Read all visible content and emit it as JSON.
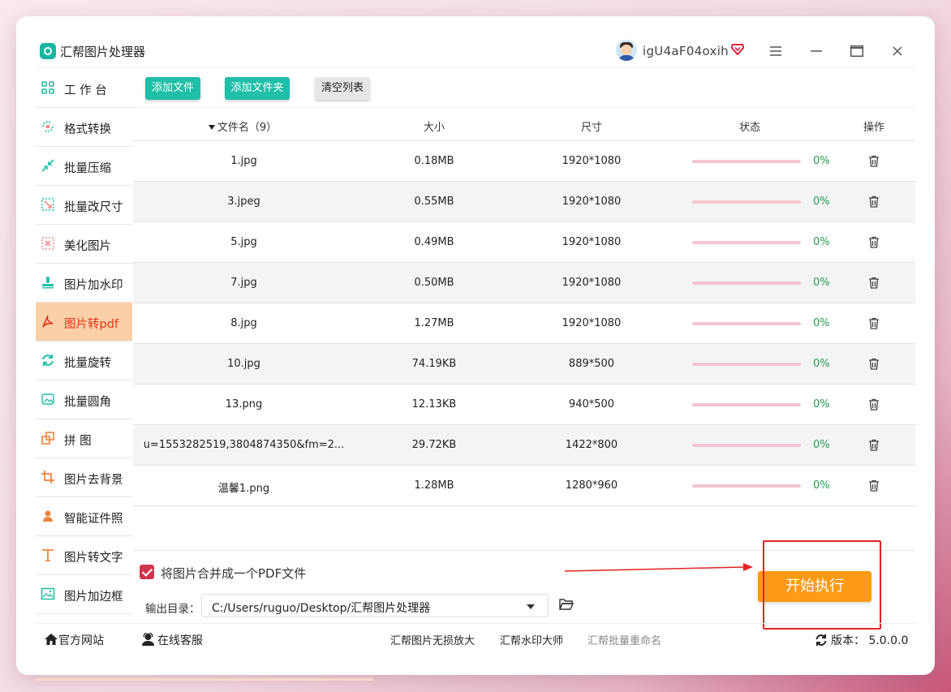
{
  "app": {
    "title": "汇帮图片处理器",
    "username": "igU4aF04oxih"
  },
  "sidebar": {
    "items": [
      {
        "label": "工 作 台",
        "icon": "grid-icon"
      },
      {
        "label": "格式转换",
        "icon": "convert-icon"
      },
      {
        "label": "批量压缩",
        "icon": "compress-icon"
      },
      {
        "label": "批量改尺寸",
        "icon": "resize-icon"
      },
      {
        "label": "美化图片",
        "icon": "beautify-icon"
      },
      {
        "label": "图片加水印",
        "icon": "watermark-icon"
      },
      {
        "label": "图片转pdf",
        "icon": "pdf-icon",
        "active": true
      },
      {
        "label": "批量旋转",
        "icon": "rotate-icon"
      },
      {
        "label": "批量圆角",
        "icon": "round-corner-icon"
      },
      {
        "label": "拼 图",
        "icon": "collage-icon"
      },
      {
        "label": "图片去背景",
        "icon": "crop-icon"
      },
      {
        "label": "智能证件照",
        "icon": "id-photo-icon"
      },
      {
        "label": "图片转文字",
        "icon": "text-icon"
      },
      {
        "label": "图片加边框",
        "icon": "frame-icon"
      }
    ]
  },
  "toolbar": {
    "add_file": "添加文件",
    "add_folder": "添加文件夹",
    "clear_list": "清空列表"
  },
  "table": {
    "headers": {
      "name": "文件名（9）",
      "size": "大小",
      "dimension": "尺寸",
      "status": "状态",
      "action": "操作"
    },
    "rows": [
      {
        "name": "1.jpg",
        "size": "0.18MB",
        "dimension": "1920*1080",
        "progress": "0%"
      },
      {
        "name": "3.jpeg",
        "size": "0.55MB",
        "dimension": "1920*1080",
        "progress": "0%"
      },
      {
        "name": "5.jpg",
        "size": "0.49MB",
        "dimension": "1920*1080",
        "progress": "0%"
      },
      {
        "name": "7.jpg",
        "size": "0.50MB",
        "dimension": "1920*1080",
        "progress": "0%"
      },
      {
        "name": "8.jpg",
        "size": "1.27MB",
        "dimension": "1920*1080",
        "progress": "0%"
      },
      {
        "name": "10.jpg",
        "size": "74.19KB",
        "dimension": "889*500",
        "progress": "0%"
      },
      {
        "name": "13.png",
        "size": "12.13KB",
        "dimension": "940*500",
        "progress": "0%"
      },
      {
        "name": "u=1553282519,3804874350&fm=2...",
        "size": "29.72KB",
        "dimension": "1422*800",
        "progress": "0%"
      },
      {
        "name": "温馨1.png",
        "size": "1.28MB",
        "dimension": "1280*960",
        "progress": "0%"
      }
    ]
  },
  "options": {
    "merge_label": "将图片合并成一个PDF文件",
    "merge_checked": true
  },
  "output": {
    "label": "输出目录：",
    "path": "C:/Users/ruguo/Desktop/汇帮图片处理器"
  },
  "start_button": "开始执行",
  "footer": {
    "website": "官方网站",
    "support": "在线客服",
    "link1": "汇帮图片无损放大",
    "link2": "汇帮水印大师",
    "link3": "汇帮批量重命名",
    "version": "版本：  5.0.0.0"
  },
  "colors": {
    "accent_green": "#1fbfa8",
    "active_bg": "#fcd0a6",
    "active_text": "#e5331b",
    "start_button": "#ff9a16",
    "highlight_box": "#e32222"
  }
}
